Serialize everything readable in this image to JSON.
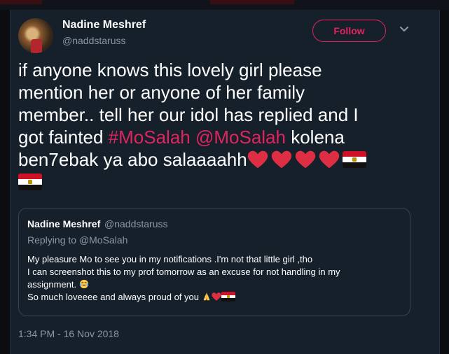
{
  "author": {
    "name": "Nadine Meshref",
    "handle": "@naddstaruss"
  },
  "follow_label": "Follow",
  "tweet": {
    "line1": "if anyone knows this lovely girl please",
    "line2": "mention her or anyone of her family",
    "line3": "member.. tell her our idol has replied and I",
    "line4_prefix": "got fainted ",
    "hashtag": "#MoSalah",
    "mention": "@MoSalah",
    "line4_suffix": "  kolena",
    "line5": "ben7ebak ya abo salaaaahh"
  },
  "quoted": {
    "name": "Nadine Meshref",
    "handle": "@naddstaruss",
    "replying_prefix": "Replying to ",
    "replying_mention": "@MoSalah",
    "body_line1": "My pleasure Mo to see you in my notifications .I'm not that little girl ,tho",
    "body_line2": "I can screenshot this to my prof tomorrow as an excuse for not handling in my",
    "body_line3": "assignment. ",
    "body_line4": "So much loveeee and always proud of you "
  },
  "timestamp": "1:34 PM - 16 Nov 2018",
  "colors": {
    "background": "#15202b",
    "accent": "#e0245e",
    "muted": "#8899a6",
    "border": "#38444d"
  },
  "icons": [
    "chevron-down-icon",
    "heart-icon",
    "egypt-flag-icon",
    "tears-of-joy-icon",
    "folded-hands-icon"
  ]
}
